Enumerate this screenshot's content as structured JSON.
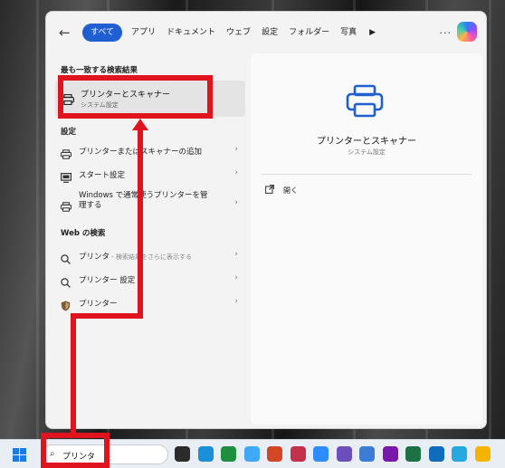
{
  "tabs": {
    "all": "すべて",
    "apps": "アプリ",
    "documents": "ドキュメント",
    "web": "ウェブ",
    "settings": "設定",
    "folders": "フォルダー",
    "photos": "写真",
    "more": "▶",
    "overflow": "..."
  },
  "left": {
    "best_match_title": "最も一致する検索結果",
    "best_match": {
      "title": "プリンターとスキャナー",
      "subtitle": "システム設定"
    },
    "settings_header": "設定",
    "settings_items": [
      "プリンターまたはスキャナーの追加",
      "スタート設定",
      "Windows で通常使うプリンターを管理する"
    ],
    "web_header": "Web の検索",
    "web_items": [
      {
        "label": "プリンタ",
        "hint": " - 検索結果をさらに表示する"
      },
      {
        "label": "プリンター 設定",
        "hint": ""
      },
      {
        "label": "プリンター",
        "hint": ""
      }
    ],
    "chevron": "›"
  },
  "right": {
    "title": "プリンターとスキャナー",
    "subtitle": "システム設定",
    "open": "開く"
  },
  "taskbar": {
    "search_value": "プリンタ",
    "icon_colors": [
      "#2b2b2b",
      "#1b8fd8",
      "#1e8f3e",
      "#3fa9f5",
      "#d24726",
      "#c4314b",
      "#2d8cff",
      "#6b4fbb",
      "#3b7dd8",
      "#7719aa",
      "#1e7145",
      "#0f6cbd",
      "#27a8e0",
      "#f4b400"
    ]
  },
  "colors": {
    "accent": "#1f5fd1",
    "annotation": "#e0141e"
  },
  "icons": [
    "back-arrow-icon",
    "printer-icon",
    "monitor-icon",
    "search-icon",
    "shield-icon",
    "open-external-icon",
    "windows-start-icon",
    "copilot-icon"
  ]
}
